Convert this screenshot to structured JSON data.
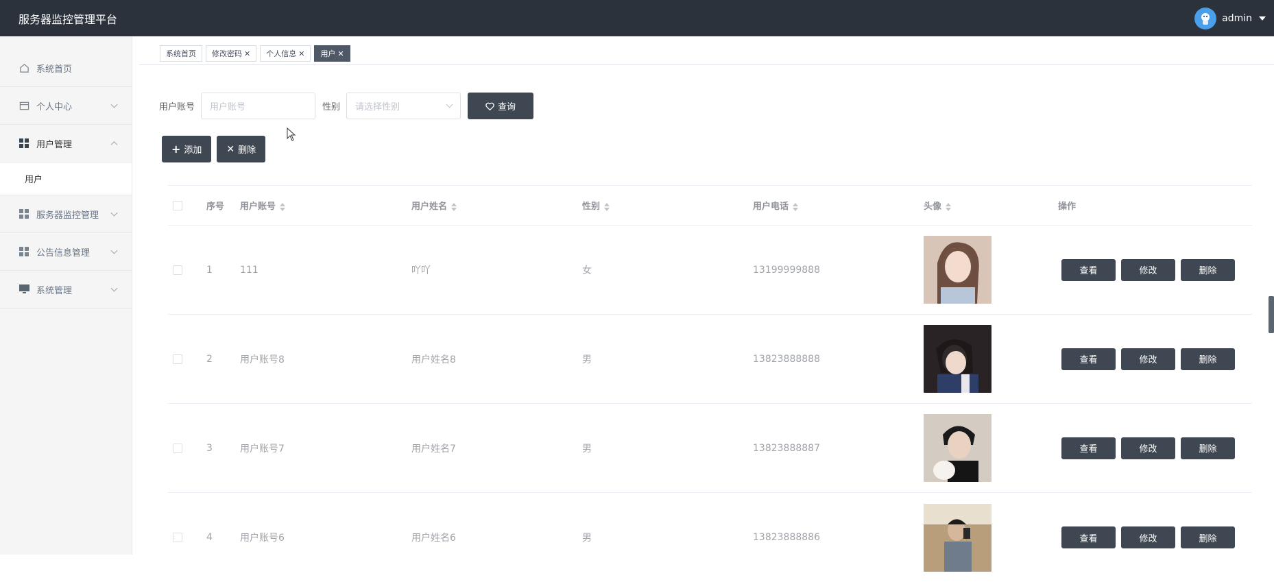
{
  "header": {
    "app_title": "服务器监控管理平台",
    "user_name": "admin"
  },
  "sidebar": {
    "items": [
      {
        "label": "系统首页",
        "icon": "home-icon",
        "has_chevron": false
      },
      {
        "label": "个人中心",
        "icon": "profile-card-icon",
        "has_chevron": true
      },
      {
        "label": "用户管理",
        "icon": "grid-icon",
        "has_chevron": true,
        "open": true
      },
      {
        "label": "服务器监控管理",
        "icon": "grid-icon",
        "has_chevron": true
      },
      {
        "label": "公告信息管理",
        "icon": "grid-icon",
        "has_chevron": true
      },
      {
        "label": "系统管理",
        "icon": "monitor-icon",
        "has_chevron": true
      }
    ],
    "submenu": [
      {
        "label": "用户"
      }
    ]
  },
  "tabs": [
    {
      "label": "系统首页",
      "closable": false,
      "active": false
    },
    {
      "label": "修改密码",
      "closable": true,
      "active": false
    },
    {
      "label": "个人信息",
      "closable": true,
      "active": false
    },
    {
      "label": "用户",
      "closable": true,
      "active": true
    }
  ],
  "search": {
    "account_label": "用户账号",
    "account_placeholder": "用户账号",
    "gender_label": "性别",
    "gender_placeholder": "请选择性别",
    "query_button": "查询"
  },
  "actions": {
    "add_label": "添加",
    "delete_label": "删除"
  },
  "table": {
    "columns": {
      "index": "序号",
      "account": "用户账号",
      "name": "用户姓名",
      "gender": "性别",
      "phone": "用户电话",
      "avatar": "头像",
      "ops": "操作"
    },
    "rows": [
      {
        "index": "1",
        "account": "111",
        "name": "吖吖",
        "gender": "女",
        "phone": "13199999888",
        "avatar_color": "#c9a28c"
      },
      {
        "index": "2",
        "account": "用户账号8",
        "name": "用户姓名8",
        "gender": "男",
        "phone": "13823888888",
        "avatar_color": "#3b2a2a"
      },
      {
        "index": "3",
        "account": "用户账号7",
        "name": "用户姓名7",
        "gender": "男",
        "phone": "13823888887",
        "avatar_color": "#cfc5bd"
      },
      {
        "index": "4",
        "account": "用户账号6",
        "name": "用户姓名6",
        "gender": "男",
        "phone": "13823888886",
        "avatar_color": "#b69a72"
      }
    ],
    "op_labels": {
      "view": "查看",
      "edit": "修改",
      "delete": "删除"
    }
  }
}
